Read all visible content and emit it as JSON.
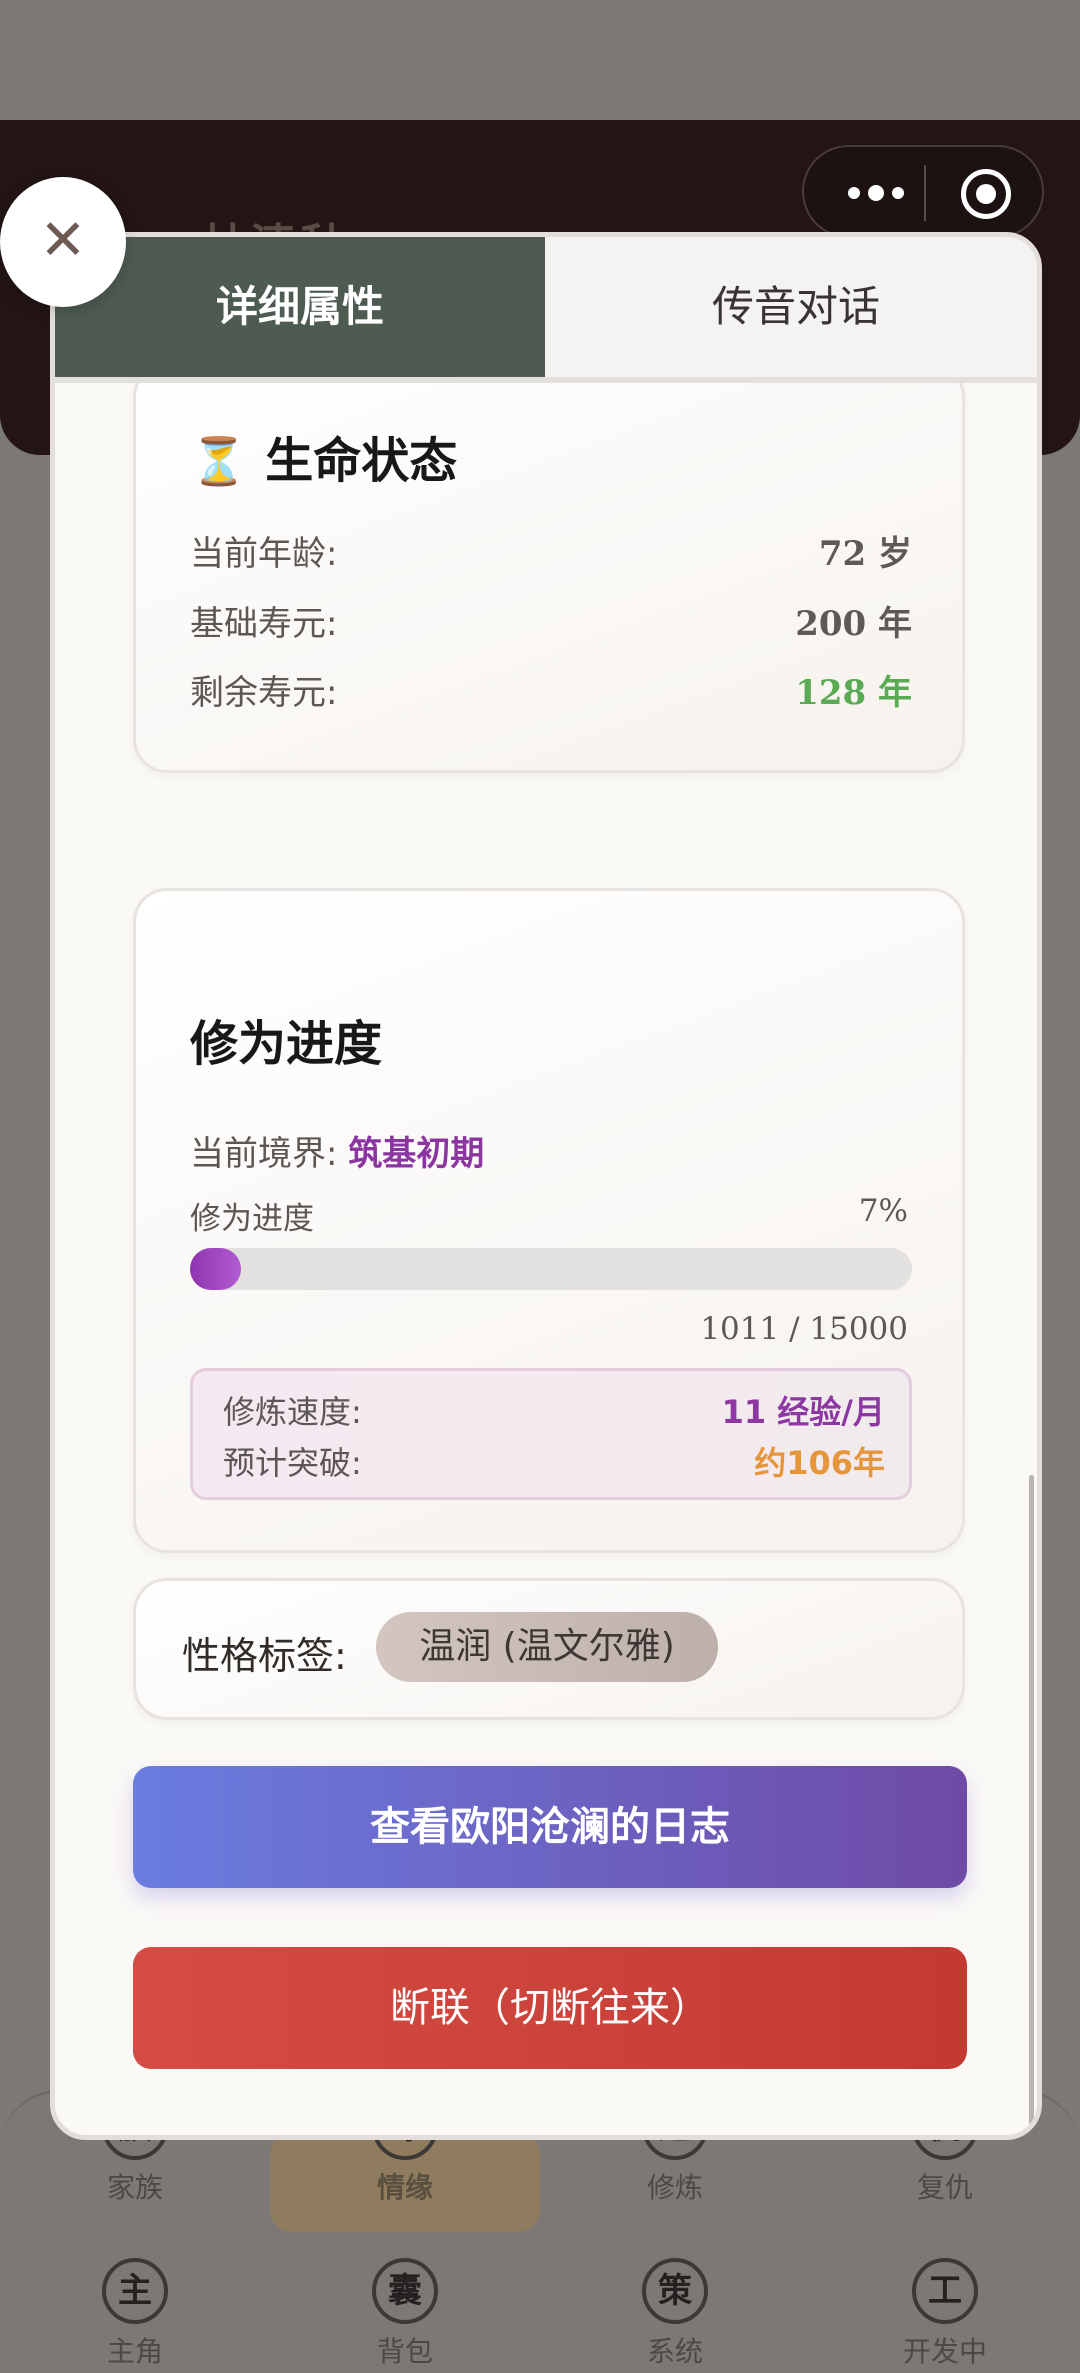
{
  "background": {
    "header_title": "林清秋",
    "bottom_nav": [
      {
        "glyph": "族",
        "label": "家族"
      },
      {
        "glyph": "缘",
        "label": "情缘"
      },
      {
        "glyph": "道",
        "label": "修炼"
      },
      {
        "glyph": "仇",
        "label": "复仇"
      },
      {
        "glyph": "主",
        "label": "主角"
      },
      {
        "glyph": "囊",
        "label": "背包"
      },
      {
        "glyph": "策",
        "label": "系统"
      },
      {
        "glyph": "工",
        "label": "开发中"
      }
    ]
  },
  "close": {
    "glyph": "✕"
  },
  "tabs": [
    {
      "label": "详细属性",
      "active": true
    },
    {
      "label": "传音对话",
      "active": false
    }
  ],
  "life": {
    "icon": "⏳",
    "title": "生命状态",
    "rows": [
      {
        "label": "当前年龄:",
        "value": "72 岁"
      },
      {
        "label": "基础寿元:",
        "value": "200 年"
      },
      {
        "label": "剩余寿元:",
        "value": "128 年"
      }
    ]
  },
  "cultivation": {
    "title": "修为进度",
    "realm_label": "当前境界:",
    "realm_value": "筑基初期",
    "progress_label": "修为进度",
    "progress_percent_text": "7%",
    "progress_fraction": 0.07,
    "progress_numbers": "1011 / 15000",
    "speed_label": "修炼速度:",
    "speed_value": "11 经验/月",
    "breakthrough_label": "预计突破:",
    "breakthrough_value": "约106年"
  },
  "trait": {
    "label": "性格标签:",
    "chip": "温润 (温文尔雅)"
  },
  "buttons": {
    "view_log": "查看欧阳沧澜的日志",
    "break_link": "断联（切断往来）"
  },
  "colors": {
    "tab_active_bg": "#4d5b51",
    "realm_purple": "#8b35a1",
    "remaining_green": "#5aa953",
    "breakthrough_orange": "#e6963a",
    "log_button_gradient": [
      "#6a7de0",
      "#6e4aa6"
    ],
    "break_button": "#d44c43"
  }
}
